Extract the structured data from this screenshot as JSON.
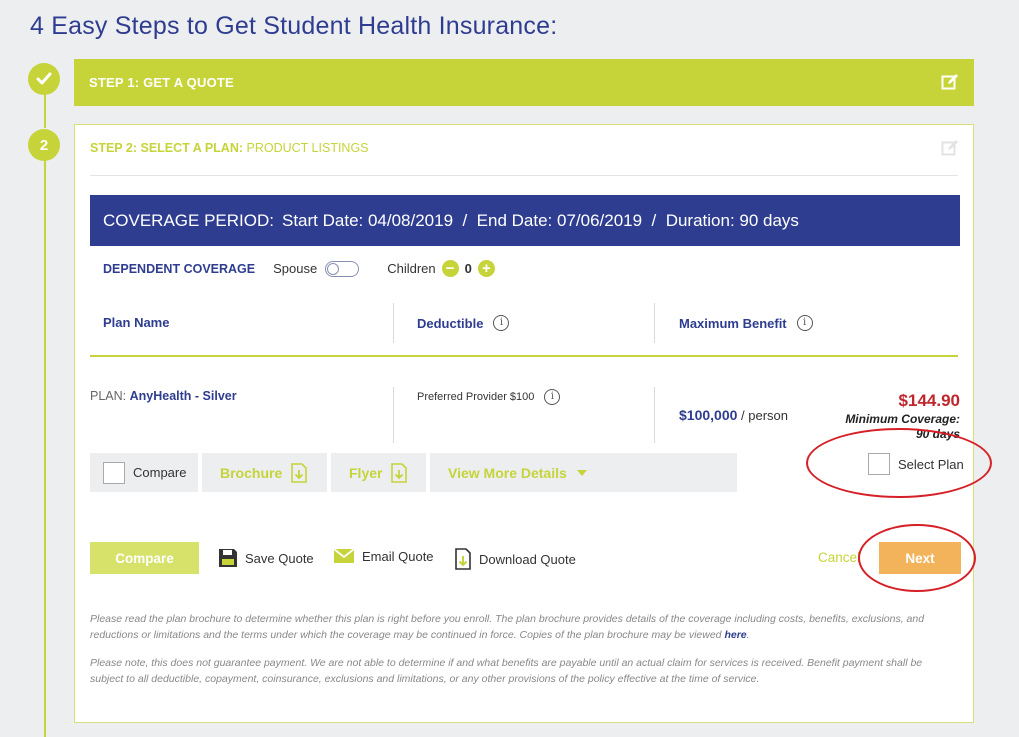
{
  "page": {
    "title": "4 Easy Steps to Get Student Health Insurance:"
  },
  "steps": {
    "step1": {
      "badge_icon": "check-icon",
      "label": "STEP 1: GET A QUOTE"
    },
    "step2": {
      "badge": "2",
      "label_bold": "STEP 2: SELECT A PLAN:",
      "label_rest": " PRODUCT LISTINGS"
    }
  },
  "coverage": {
    "prefix": "COVERAGE PERIOD:",
    "text": "Start Date: 04/08/2019  /  End Date: 07/06/2019  /  Duration: 90 days"
  },
  "dependent": {
    "label": "DEPENDENT COVERAGE",
    "spouse_label": "Spouse",
    "children_label": "Children",
    "children_count": "0",
    "minus": "−",
    "plus": "+"
  },
  "columns": {
    "plan_name": "Plan Name",
    "deductible": "Deductible",
    "max_benefit": "Maximum Benefit"
  },
  "plan": {
    "prefix": "PLAN: ",
    "name": "AnyHealth - Silver",
    "deductible": "Preferred Provider $100",
    "max_benefit_amount": "$100,000",
    "max_benefit_suffix": " / person",
    "price": "$144.90",
    "min_coverage": "Minimum Coverage: 90 days",
    "compare_label": "Compare",
    "brochure_label": "Brochure",
    "flyer_label": "Flyer",
    "more_details_label": "View More Details",
    "select_label": "Select Plan"
  },
  "footer_actions": {
    "compare": "Compare",
    "save_quote": "Save Quote",
    "email_quote": "Email Quote",
    "download_quote": "Download Quote",
    "cancel": "Cancel",
    "next": "Next"
  },
  "disclaimers": {
    "d1": "Please read the plan brochure to determine whether this plan is right before you enroll. The plan brochure provides details of the coverage including costs, benefits, exclusions, and reductions or limitations and the terms under which the coverage may be continued in force. Copies of the plan brochure may be viewed ",
    "d1_link": "here",
    "d1_end": ".",
    "d2": "Please note, this does not guarantee payment. We are not able to determine if and what benefits are payable until an actual claim for services is received. Benefit payment shall be subject to all deductible, copayment, coinsurance, exclusions and limitations, or any other provisions of the policy effective at the time of service."
  },
  "colors": {
    "lime": "#c6d43a",
    "navy": "#2f3d91",
    "price_red": "#c0272d",
    "next_orange": "#f2b35a",
    "annotation_red": "#d61f26"
  }
}
